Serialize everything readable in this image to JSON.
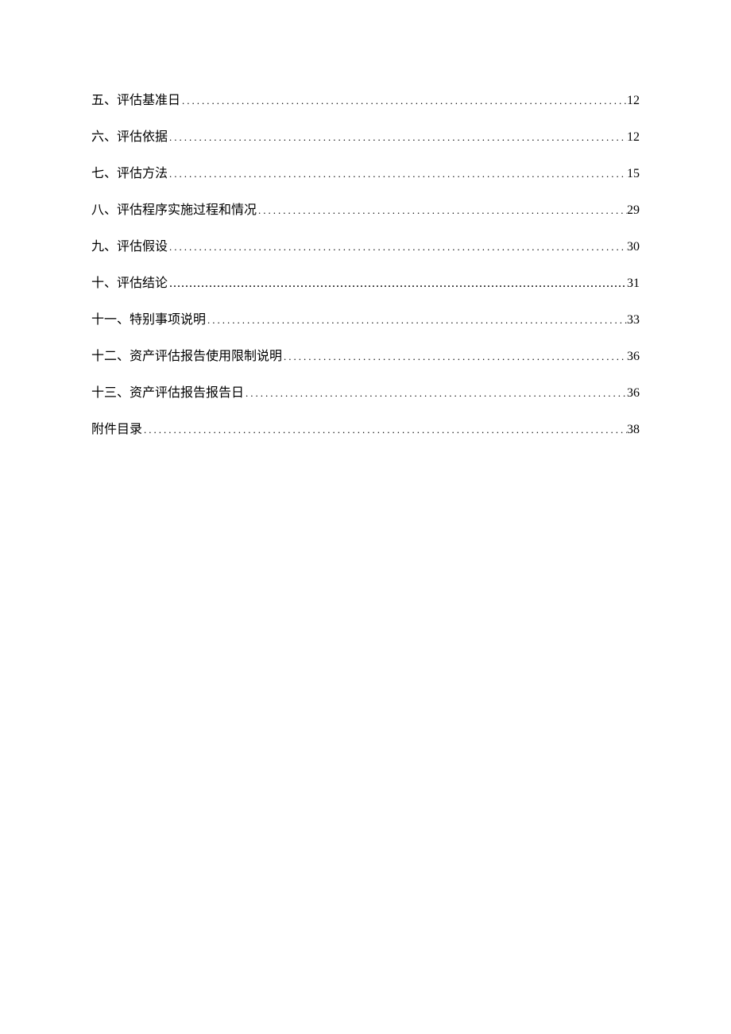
{
  "toc": {
    "entries": [
      {
        "title": "五、评估基准日",
        "page": "12",
        "special": false
      },
      {
        "title": "六、评估依据",
        "page": "12",
        "special": false
      },
      {
        "title": "七、评估方法",
        "page": "15",
        "special": false
      },
      {
        "title": "八、评估程序实施过程和情况",
        "page": "29",
        "special": false
      },
      {
        "title": "九、评估假设",
        "page": "30",
        "special": false
      },
      {
        "title": "十、评估结论",
        "page": "31",
        "special": true
      },
      {
        "title": "十一、特别事项说明",
        "page": "33",
        "special": false
      },
      {
        "title": "十二、资产评估报告使用限制说明",
        "page": "36",
        "special": false
      },
      {
        "title": "十三、资产评估报告报告日",
        "page": "36",
        "special": false
      },
      {
        "title": "附件目录",
        "page": "38",
        "special": false
      }
    ]
  }
}
